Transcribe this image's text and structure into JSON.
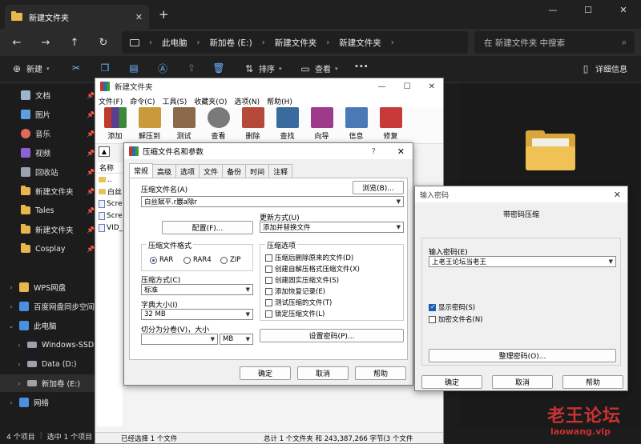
{
  "explorer": {
    "tab_title": "新建文件夹",
    "tab_close": "✕",
    "tab_add": "+",
    "window_controls": [
      "—",
      "☐",
      "✕"
    ],
    "nav": [
      "←",
      "→",
      "↑",
      "↻"
    ],
    "breadcrumb": [
      "此电脑",
      "新加卷 (E:)",
      "新建文件夹",
      "新建文件夹"
    ],
    "breadcrumb_sep": "›",
    "search_placeholder": "在 新建文件夹 中搜索",
    "search_icon": "⌕",
    "commands": {
      "new_label": "新建",
      "sort_label": "排序",
      "view_label": "查看",
      "more_label": "•••",
      "details_label": "详细信息"
    },
    "sidebar": [
      {
        "label": "文档",
        "icon": "document-icon",
        "color": "#9fb4cc",
        "pinned": true
      },
      {
        "label": "图片",
        "icon": "pictures-icon",
        "color": "#5aa0e0",
        "pinned": true
      },
      {
        "label": "音乐",
        "icon": "music-icon",
        "color": "#e36a5a",
        "pinned": true
      },
      {
        "label": "视频",
        "icon": "video-icon",
        "color": "#8a62d6",
        "pinned": true
      },
      {
        "label": "回收站",
        "icon": "recycle-bin-icon",
        "color": "#9aa3ad",
        "pinned": true
      },
      {
        "label": "新建文件夹",
        "icon": "folder-icon",
        "color": "#e8b64a",
        "pinned": true
      },
      {
        "label": "Tales",
        "icon": "folder-icon",
        "color": "#e8b64a",
        "pinned": true
      },
      {
        "label": "新建文件夹",
        "icon": "folder-icon",
        "color": "#e8b64a",
        "pinned": true
      },
      {
        "label": "Cosplay",
        "icon": "folder-icon",
        "color": "#e8b64a",
        "pinned": true
      },
      {
        "label": "WPS网盘",
        "icon": "cloud-icon",
        "color": "#e8b64a",
        "pinned": false
      },
      {
        "label": "百度网盘同步空间",
        "icon": "cloud-icon",
        "color": "#4b8fe0",
        "pinned": false
      },
      {
        "label": "此电脑",
        "icon": "computer-icon",
        "color": "#4b8fe0",
        "pinned": false
      },
      {
        "label": "Windows-SSD (C:)",
        "icon": "drive-icon",
        "color": "#9aa3ad",
        "pinned": false
      },
      {
        "label": "Data (D:)",
        "icon": "drive-icon",
        "color": "#9aa3ad",
        "pinned": false
      },
      {
        "label": "新加卷 (E:)",
        "icon": "drive-icon",
        "color": "#9aa3ad",
        "pinned": false
      },
      {
        "label": "网络",
        "icon": "network-icon",
        "color": "#4b8fe0",
        "pinned": false
      }
    ],
    "status": {
      "items": "4 个项目",
      "selected": "选中 1 个项目"
    }
  },
  "winrar": {
    "title": "新建文件夹",
    "menu": [
      "文件(F)",
      "命令(C)",
      "工具(S)",
      "收藏夹(O)",
      "选项(N)",
      "帮助(H)"
    ],
    "tools": [
      {
        "label": "添加",
        "color": "#7a5a9e"
      },
      {
        "label": "解压到",
        "color": "#c99a3a"
      },
      {
        "label": "测试",
        "color": "#8a6a4a"
      },
      {
        "label": "查看",
        "color": "#7a7a7a"
      },
      {
        "label": "删除",
        "color": "#b54a3a"
      },
      {
        "label": "查找",
        "color": "#3a6a9e"
      },
      {
        "label": "向导",
        "color": "#9e3a8a"
      },
      {
        "label": "信息",
        "color": "#4a7ab5"
      },
      {
        "label": "修复",
        "color": "#c73a3a"
      }
    ],
    "list_header": "名称",
    "list": [
      {
        "name": "..",
        "type": "folder"
      },
      {
        "name": "白丝",
        "type": "folder"
      },
      {
        "name": "Scre",
        "type": "file"
      },
      {
        "name": "Scre",
        "type": "file"
      },
      {
        "name": "VID_",
        "type": "file"
      }
    ],
    "status_left": "已经选择 1 个文件",
    "status_right": "总计 1 个文件夹 和 243,387,266 字节(3 个文件"
  },
  "archive_dialog": {
    "title": "压缩文件名和参数",
    "help_mark": "?",
    "tabs": [
      "常规",
      "高级",
      "选项",
      "文件",
      "备份",
      "时间",
      "注释"
    ],
    "archive_name_label": "压缩文件名(A)",
    "browse_button": "浏览(B)...",
    "archive_name_value": "白丝賦平.r巖a除r",
    "profiles_button": "配置(F)...",
    "update_mode_label": "更新方式(U)",
    "update_mode_value": "添加并替换文件",
    "format_group_label": "压缩文件格式",
    "formats": [
      "RAR",
      "RAR4",
      "ZIP"
    ],
    "format_selected": "RAR",
    "method_label": "压缩方式(C)",
    "method_value": "标准",
    "dict_label": "字典大小(I)",
    "dict_value": "32 MB",
    "split_label": "切分为分卷(V)，大小",
    "split_unit": "MB",
    "options_group_label": "压缩选项",
    "options": [
      {
        "label": "压缩后删除原来的文件(D)",
        "checked": false
      },
      {
        "label": "创建自解压格式压缩文件(X)",
        "checked": false
      },
      {
        "label": "创建固实压缩文件(S)",
        "checked": false
      },
      {
        "label": "添加恢复记录(E)",
        "checked": false
      },
      {
        "label": "测试压缩的文件(T)",
        "checked": false
      },
      {
        "label": "锁定压缩文件(L)",
        "checked": false
      }
    ],
    "set_password_button": "设置密码(P)...",
    "ok_button": "确定",
    "cancel_button": "取消",
    "help_button": "帮助"
  },
  "password_dialog": {
    "title": "输入密码",
    "heading": "带密码压缩",
    "password_label": "输入密码(E)",
    "password_value": "上老王论坛当老王",
    "show_password_label": "显示密码(S)",
    "show_password_checked": true,
    "encrypt_names_label": "加密文件名(N)",
    "encrypt_names_checked": false,
    "organize_button": "整理密码(O)...",
    "ok_button": "确定",
    "cancel_button": "取消",
    "help_button": "帮助"
  },
  "watermark": {
    "main": "老王论坛",
    "sub": "laowang.vip"
  }
}
